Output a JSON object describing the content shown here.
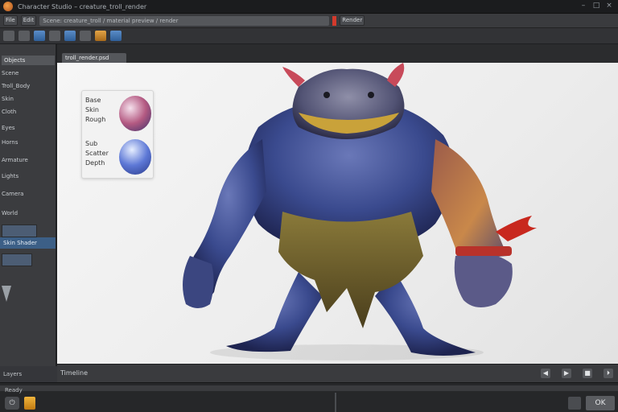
{
  "window": {
    "title": "Character Studio – creature_troll_render",
    "controls": [
      "–",
      "□",
      "×"
    ]
  },
  "toolbar1": {
    "file_label": "File",
    "edit_label": "Edit",
    "path_text": "Scene: creature_troll / material preview / render",
    "mode_label": "Render"
  },
  "toolbar2": {
    "icons": [
      "select-icon",
      "move-icon",
      "rotate-icon",
      "scale-icon",
      "material-icon",
      "light-icon",
      "camera-icon",
      "render-icon"
    ]
  },
  "left_panel": {
    "header": "Objects",
    "items": [
      "Scene",
      "Troll_Body",
      "Skin",
      "Cloth",
      "Eyes",
      "Horns",
      "Armature",
      "Lights",
      "Camera",
      "World"
    ],
    "selected": "Skin Shader"
  },
  "document_tab": "troll_render.psd",
  "swatches": [
    {
      "labels": [
        "Base",
        "Skin",
        "Rough"
      ],
      "color": "#b45a82"
    },
    {
      "labels": [
        "Sub",
        "Scatter",
        "Depth"
      ],
      "color": "#5d78d6"
    }
  ],
  "timeline": {
    "label": "Timeline",
    "buttons": [
      "◀",
      "▶",
      "■",
      "⏵"
    ]
  },
  "left_footer": "Layers",
  "statusbar": {
    "text": "Ready",
    "apply_label": "OK"
  },
  "colors": {
    "accent": "#d33a2c",
    "selection": "#3c5f86",
    "canvas": "#f0f0f0"
  }
}
